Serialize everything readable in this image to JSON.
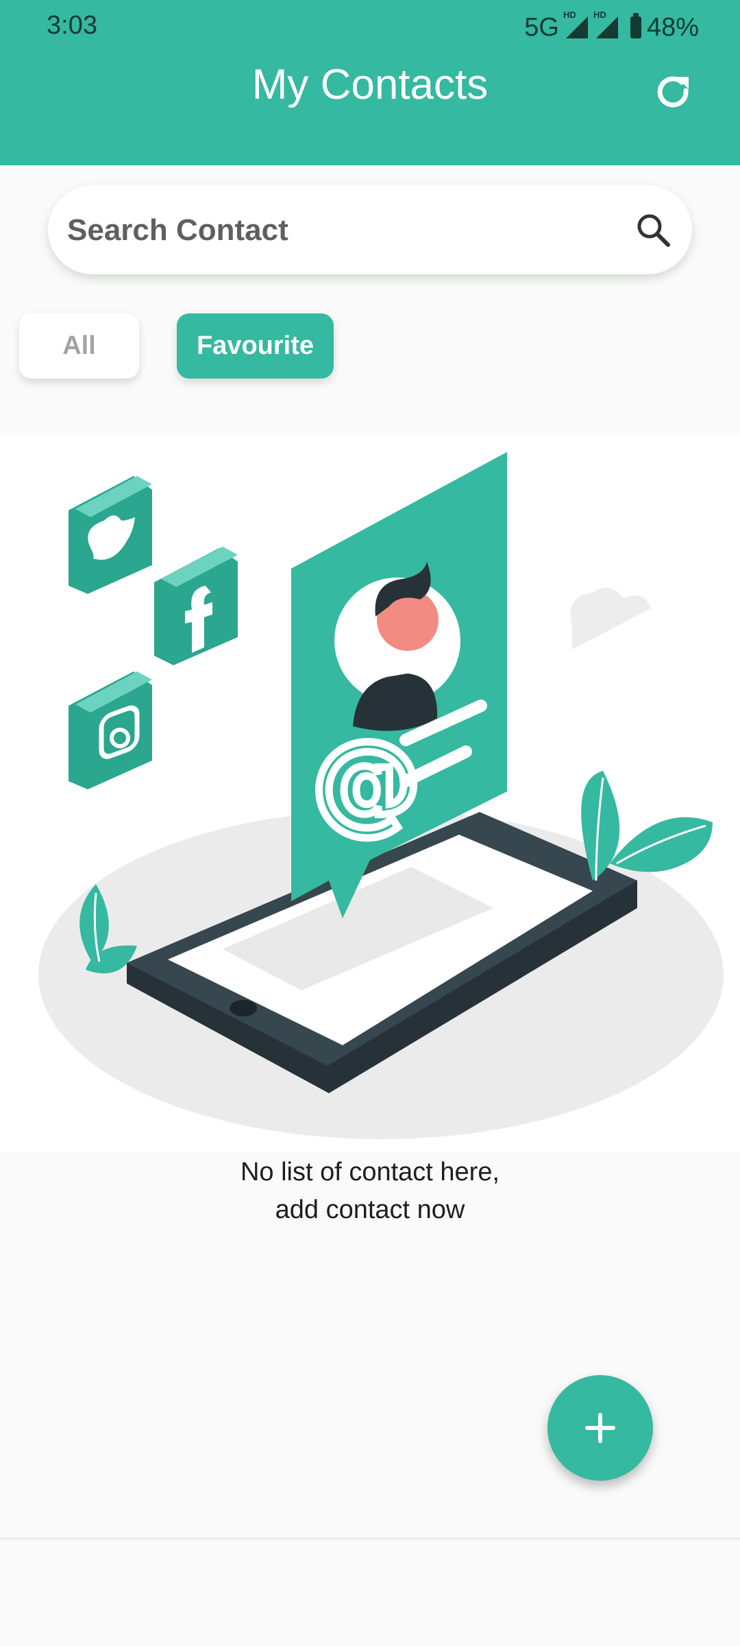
{
  "status_bar": {
    "time": "3:03",
    "network": "5G",
    "sim1_tag": "HD",
    "sim2_tag": "HD",
    "battery": "48%"
  },
  "header": {
    "title": "My Contacts",
    "refresh_icon": "refresh-icon"
  },
  "search": {
    "placeholder": "Search Contact",
    "value": "",
    "icon": "search-icon"
  },
  "filters": [
    {
      "label": "All",
      "selected": false
    },
    {
      "label": "Favourite",
      "selected": true
    }
  ],
  "empty_state": {
    "message_line1": "No list of contact here,",
    "message_line2": "add contact now"
  },
  "fab": {
    "icon": "plus-icon"
  },
  "colors": {
    "primary": "#35b9a0",
    "background": "#f9faf9",
    "dark": "#37474f"
  }
}
